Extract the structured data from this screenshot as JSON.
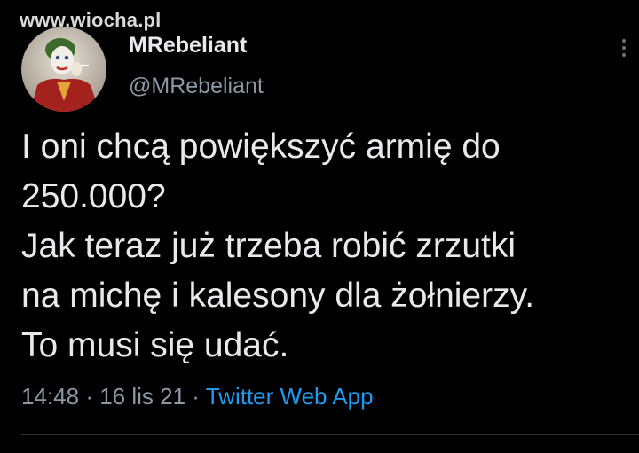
{
  "watermark": "www.wiocha.pl",
  "author": {
    "display_name": "MRebeliant",
    "handle": "@MRebeliant",
    "avatar_icon": "joker-avatar"
  },
  "tweet": {
    "text": "I oni chcą powiększyć armię do\n250.000?\nJak teraz już trzeba robić zrzutki\nna michę i kalesony dla żołnierzy.\nTo musi się udać.",
    "time": "14:48",
    "date": "16 lis 21",
    "separator": "·",
    "source": "Twitter Web App"
  },
  "icons": {
    "more": "more-vertical-icon"
  },
  "colors": {
    "background": "#000000",
    "text": "#e7e9ea",
    "secondary": "#8b98a5",
    "link": "#1d9bf0"
  }
}
